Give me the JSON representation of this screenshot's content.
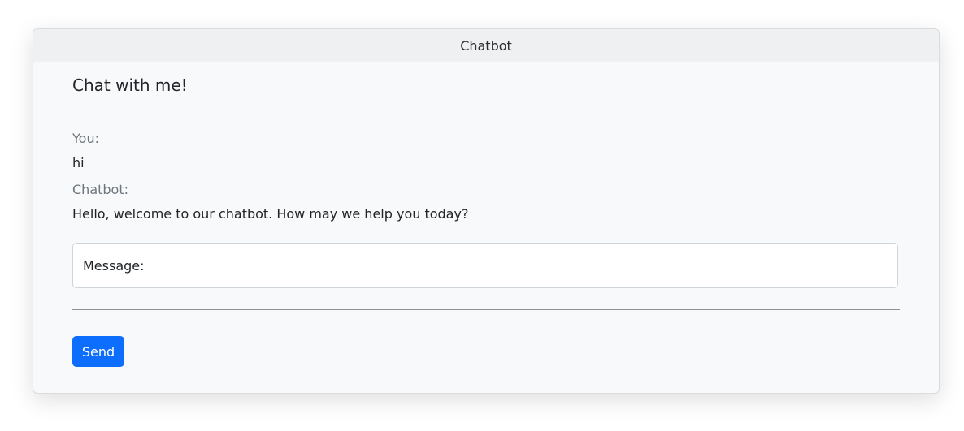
{
  "window": {
    "title": "Chatbot"
  },
  "chat": {
    "heading": "Chat with me!",
    "messages": [
      {
        "speaker": "You:",
        "text": "hi"
      },
      {
        "speaker": "Chatbot:",
        "text": "Hello, welcome to our chatbot. How may we help you today?"
      }
    ],
    "input": {
      "label": "Message:",
      "value": "",
      "placeholder": ""
    },
    "send_label": "Send"
  },
  "colors": {
    "accent": "#0d6efd",
    "card_background": "#f8f9fa",
    "header_background": "#eff0f2",
    "muted_text": "#6c757d"
  }
}
